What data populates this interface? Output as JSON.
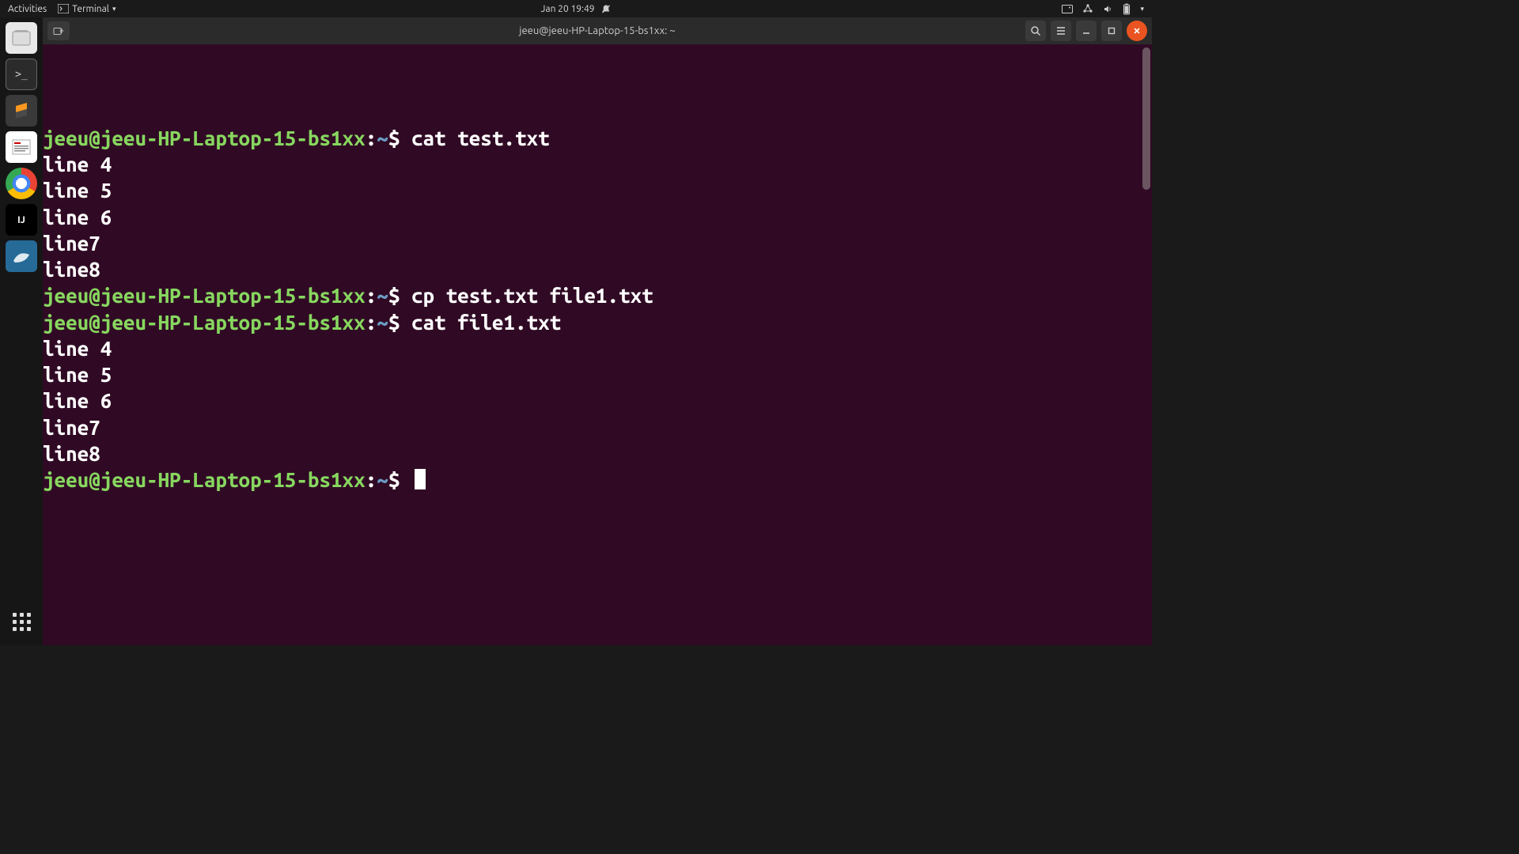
{
  "top_panel": {
    "activities": "Activities",
    "app_name": "Terminal",
    "datetime": "Jan 20  19:49"
  },
  "dock": {
    "items": [
      "files",
      "terminal",
      "sublime",
      "pdf",
      "chrome",
      "intellij",
      "mysql"
    ]
  },
  "window": {
    "title": "jeeu@jeeu-HP-Laptop-15-bs1xx: ~"
  },
  "prompt": {
    "user_host": "jeeu@jeeu-HP-Laptop-15-bs1xx",
    "sep": ":",
    "path": "~",
    "dollar": "$"
  },
  "session": [
    {
      "type": "cmd",
      "text": "cat test.txt"
    },
    {
      "type": "out",
      "text": "line 4"
    },
    {
      "type": "out",
      "text": "line 5"
    },
    {
      "type": "out",
      "text": "line 6"
    },
    {
      "type": "out",
      "text": "line7"
    },
    {
      "type": "out",
      "text": "line8"
    },
    {
      "type": "cmd",
      "text": "cp test.txt file1.txt"
    },
    {
      "type": "cmd",
      "text": "cat file1.txt"
    },
    {
      "type": "out",
      "text": "line 4"
    },
    {
      "type": "out",
      "text": "line 5"
    },
    {
      "type": "out",
      "text": "line 6"
    },
    {
      "type": "out",
      "text": "line7"
    },
    {
      "type": "out",
      "text": "line8"
    },
    {
      "type": "cmd",
      "text": "",
      "cursor": true
    }
  ]
}
